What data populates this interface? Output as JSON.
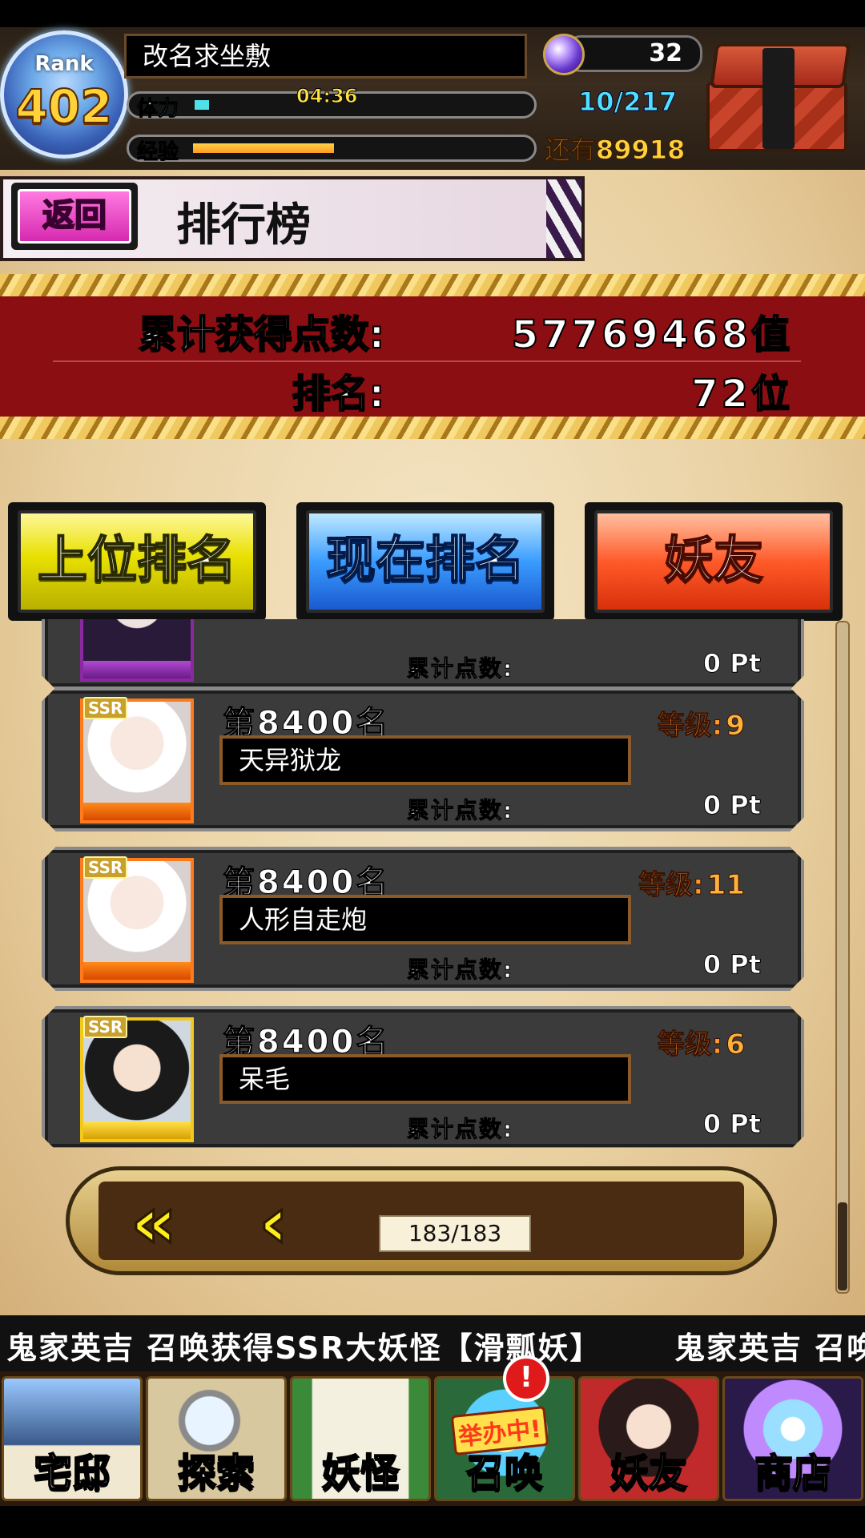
{
  "hud": {
    "rank_label": "Rank",
    "rank_value": "402",
    "player_name": "改名求坐敷",
    "stamina_label": "体力",
    "stamina_timer": "04:36",
    "stamina_count": "10/217",
    "exp_label": "经验",
    "exp_remaining": "还有89918",
    "gems": "32",
    "stamina_fill": 0.046,
    "exp_fill": 0.44
  },
  "header": {
    "back_label": "返回",
    "title": "排行榜"
  },
  "stats": {
    "total_points_label": "累计获得点数:",
    "total_points_value": "57769468值",
    "rank_label": "排名:",
    "rank_value": "72位"
  },
  "tabs": [
    {
      "label": "上位排名"
    },
    {
      "label": "现在排名"
    },
    {
      "label": "妖友"
    }
  ],
  "rows": [
    {
      "rank": "",
      "name": "",
      "level_label": "",
      "level": "",
      "points_label": "累计点数:",
      "points": "0 Pt",
      "rarity": ""
    },
    {
      "rank": "第8400名",
      "name": "天异狱龙",
      "level_label": "等级:",
      "level": "9",
      "points_label": "累计点数:",
      "points": "0 Pt",
      "rarity": "SSR"
    },
    {
      "rank": "第8400名",
      "name": "人形自走炮",
      "level_label": "等级:",
      "level": "11",
      "points_label": "累计点数:",
      "points": "0 Pt",
      "rarity": "SSR"
    },
    {
      "rank": "第8400名",
      "name": "呆毛",
      "level_label": "等级:",
      "level": "6",
      "points_label": "累计点数:",
      "points": "0 Pt",
      "rarity": "SSR"
    }
  ],
  "pager": {
    "first_icon": "double-chevron-left-icon",
    "prev_icon": "chevron-left-icon",
    "page_indicator": "183/183"
  },
  "ticker": {
    "message": "鬼家英吉 召唤获得SSR大妖怪【滑瓢妖】",
    "message_repeat": "鬼家英吉 召唤"
  },
  "nav": {
    "items": [
      {
        "label": "宅邸",
        "icon": "house-icon"
      },
      {
        "label": "探索",
        "icon": "magnifier-icon"
      },
      {
        "label": "妖怪",
        "icon": "scroll-icon"
      },
      {
        "label": "召唤",
        "icon": "summon-star-icon"
      },
      {
        "label": "妖友",
        "icon": "friend-girl-icon"
      },
      {
        "label": "商店",
        "icon": "crystal-orb-icon"
      }
    ],
    "summon_badge": "举办中!",
    "alert_mark": "!"
  },
  "colors": {
    "stats_band": "#8a0e12",
    "tab_top": "#e8e000",
    "tab_current": "#3a9cff",
    "tab_friends": "#ff5a2a"
  }
}
